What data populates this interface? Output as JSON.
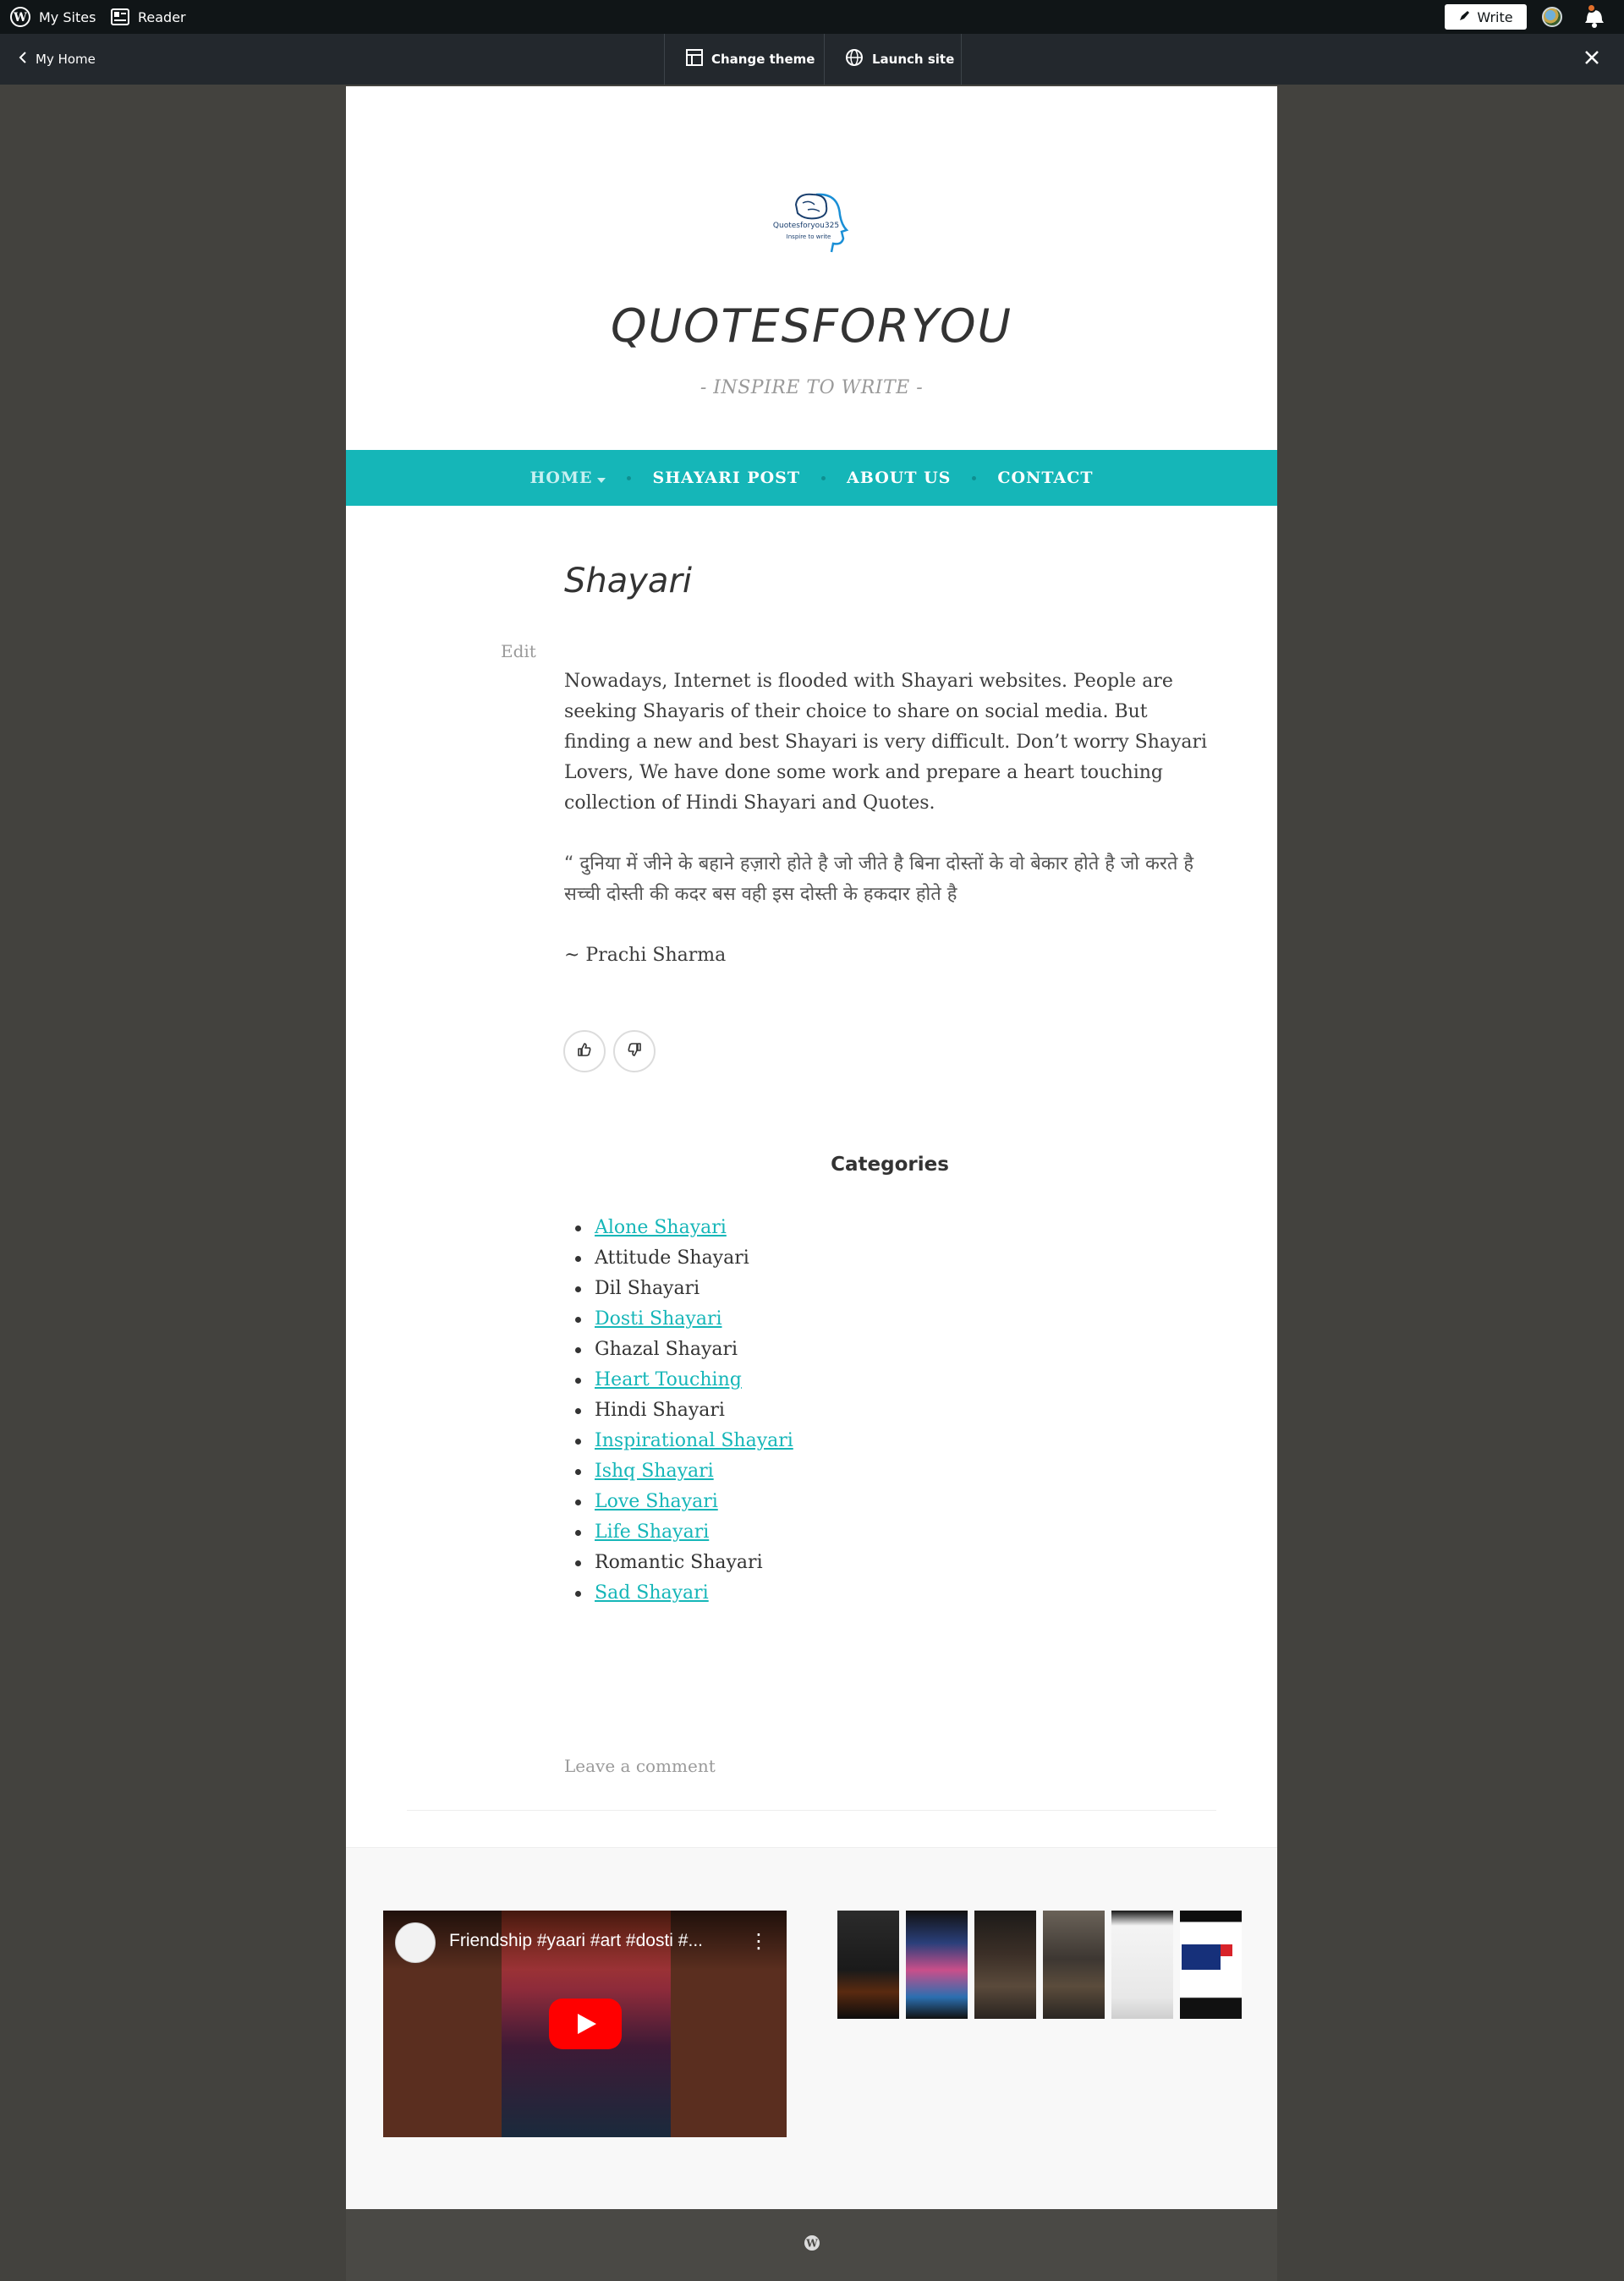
{
  "adminbar": {
    "my_sites": "My Sites",
    "reader": "Reader",
    "write": "Write"
  },
  "subbar": {
    "back": "My Home",
    "change_theme": "Change theme",
    "launch_site": "Launch site"
  },
  "site": {
    "logo_text": "Quotesforyou325",
    "logo_tagline": "Inspire to write",
    "title": "QUOTESFORYOU",
    "description": "- INSPIRE TO WRITE -"
  },
  "nav": {
    "items": [
      {
        "label": "HOME"
      },
      {
        "label": "SHAYARI POST"
      },
      {
        "label": "ABOUT US"
      },
      {
        "label": "CONTACT"
      }
    ]
  },
  "post": {
    "title": "Shayari",
    "edit": "Edit",
    "intro": "Nowadays, Internet is flooded with Shayari websites. People are seeking Shayaris of their choice to share on social media. But finding a new and best Shayari is very difficult. Don’t worry Shayari Lovers, We have done some work and prepare a heart touching collection of Hindi Shayari and Quotes.",
    "quote_line1": "“ दुनिया में जीने के बहाने हज़ारो होते है जो जीते है बिना दोस्तों के वो बेकार होते है जो करते है",
    "quote_line2": "सच्ची दोस्ती की कदर बस वही इस दोस्ती के हकदार होते है",
    "author": "~ Prachi Sharma",
    "leave_comment": "Leave a comment"
  },
  "categories": {
    "title": "Categories",
    "items": [
      {
        "label": "Alone Shayari",
        "link": true
      },
      {
        "label": "Attitude Shayari",
        "link": false
      },
      {
        "label": "Dil Shayari",
        "link": false
      },
      {
        "label": "Dosti Shayari",
        "link": true
      },
      {
        "label": "Ghazal Shayari",
        "link": false
      },
      {
        "label": "Heart Touching",
        "link": true
      },
      {
        "label": "Hindi Shayari",
        "link": false
      },
      {
        "label": "Inspirational Shayari",
        "link": true
      },
      {
        "label": "Ishq Shayari",
        "link": true
      },
      {
        "label": "Love Shayari",
        "link": true
      },
      {
        "label": "Life Shayari",
        "link": true
      },
      {
        "label": "Romantic Shayari",
        "link": false
      },
      {
        "label": "Sad Shayari",
        "link": true
      }
    ]
  },
  "video": {
    "title": "Friendship #yaari #art #dosti #..."
  },
  "colors": {
    "accent": "#15b6b8",
    "admin_bar": "#101517",
    "sub_bar": "#23282d",
    "backdrop": "#43423e"
  }
}
